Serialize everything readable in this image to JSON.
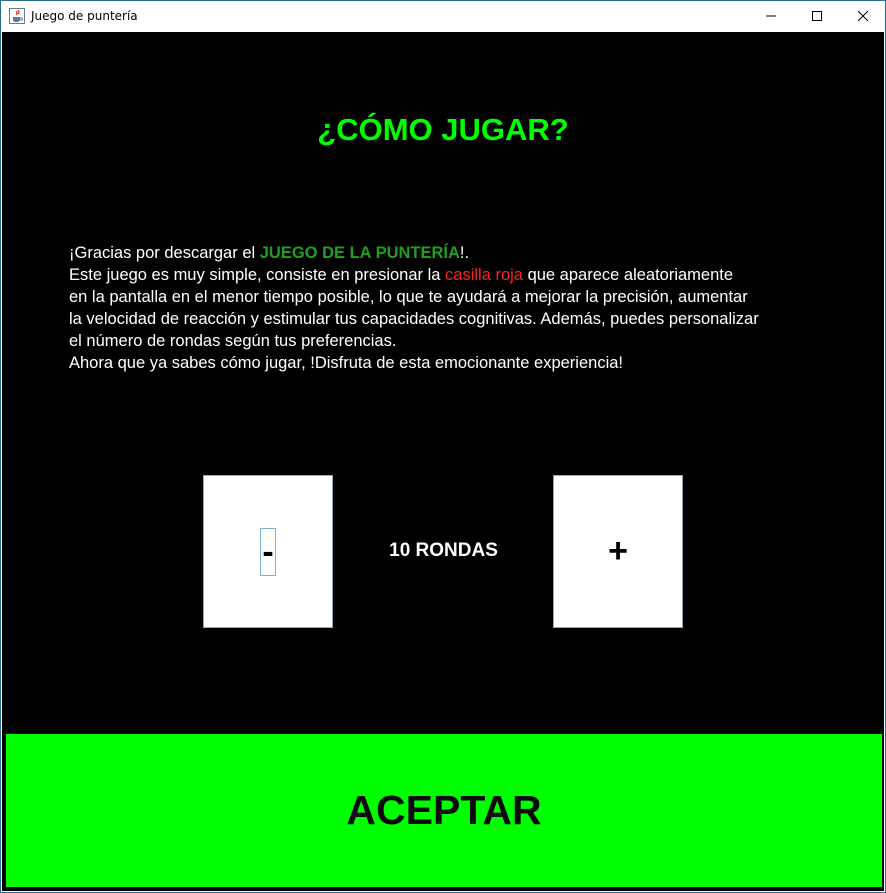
{
  "window": {
    "title": "Juego de puntería",
    "icon": "java-cup-icon",
    "controls": [
      "minimize-icon",
      "maximize-icon",
      "close-icon"
    ]
  },
  "heading": "¿CÓMO JUGAR?",
  "instructions": {
    "line1_prefix": "¡Gracias por descargar el ",
    "line1_highlight": "JUEGO DE LA PUNTERÍA",
    "line1_suffix": "!.",
    "line2_prefix": "Este juego es muy simple, consiste en presionar la ",
    "line2_highlight": "casilla roja",
    "line2_suffix": " que aparece aleatoriamente",
    "line3": "en la pantalla en el menor tiempo posible, lo que te ayudará a mejorar la precisión, aumentar",
    "line4": "la velocidad de reacción y estimular tus capacidades cognitivas. Además, puedes personalizar",
    "line5": "el número de rondas según tus preferencias.",
    "line6": "Ahora que ya sabes cómo jugar, !Disfruta de esta emocionante experiencia!"
  },
  "rounds": {
    "decrease_label": "-",
    "increase_label": "+",
    "display": "10 RONDAS"
  },
  "accept_label": "ACEPTAR",
  "colors": {
    "background": "#000000",
    "heading": "#00ff00",
    "highlight_game": "#1fa01f",
    "highlight_red": "#ff2020",
    "accept_bg": "#00ff00"
  }
}
